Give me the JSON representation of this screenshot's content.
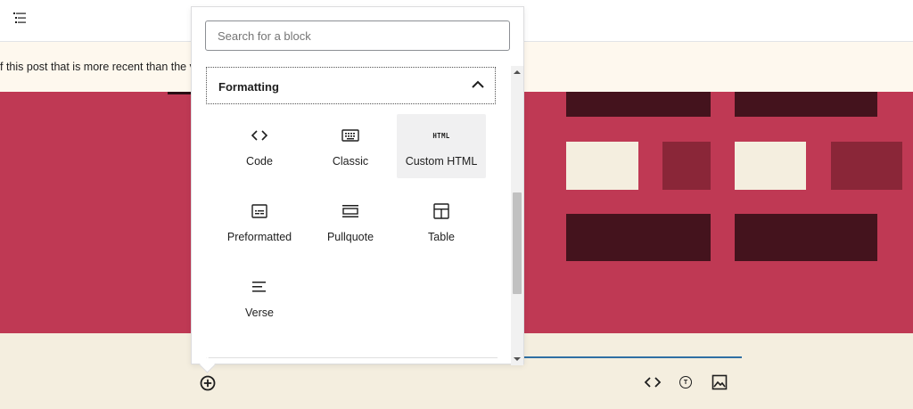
{
  "notice": {
    "text": "f this post that is more recent than the ve"
  },
  "inserter": {
    "search": {
      "placeholder": "Search for a block",
      "value": ""
    },
    "category": {
      "title": "Formatting",
      "expanded": true
    },
    "blocks": [
      {
        "label": "Code",
        "icon": "code-icon"
      },
      {
        "label": "Classic",
        "icon": "keyboard-icon"
      },
      {
        "label": "Custom HTML",
        "icon": "html-icon",
        "icon_text": "HTML",
        "highlighted": true
      },
      {
        "label": "Preformatted",
        "icon": "preformatted-icon"
      },
      {
        "label": "Pullquote",
        "icon": "pullquote-icon"
      },
      {
        "label": "Table",
        "icon": "table-icon"
      },
      {
        "label": "Verse",
        "icon": "verse-icon"
      }
    ]
  },
  "toolbar_bottom": {
    "add_block_icon": "plus-circle-icon",
    "icons": [
      "code-icon",
      "text-circle-icon",
      "image-icon"
    ],
    "text_circle_letter": "T"
  },
  "colors": {
    "accent_red": "#bf3954",
    "dark_tile": "#44131d",
    "mid_tile": "#8a2638",
    "cream": "#f4eedf",
    "notice_bg": "#fef8ee",
    "link_blue": "#2f6fa3"
  }
}
